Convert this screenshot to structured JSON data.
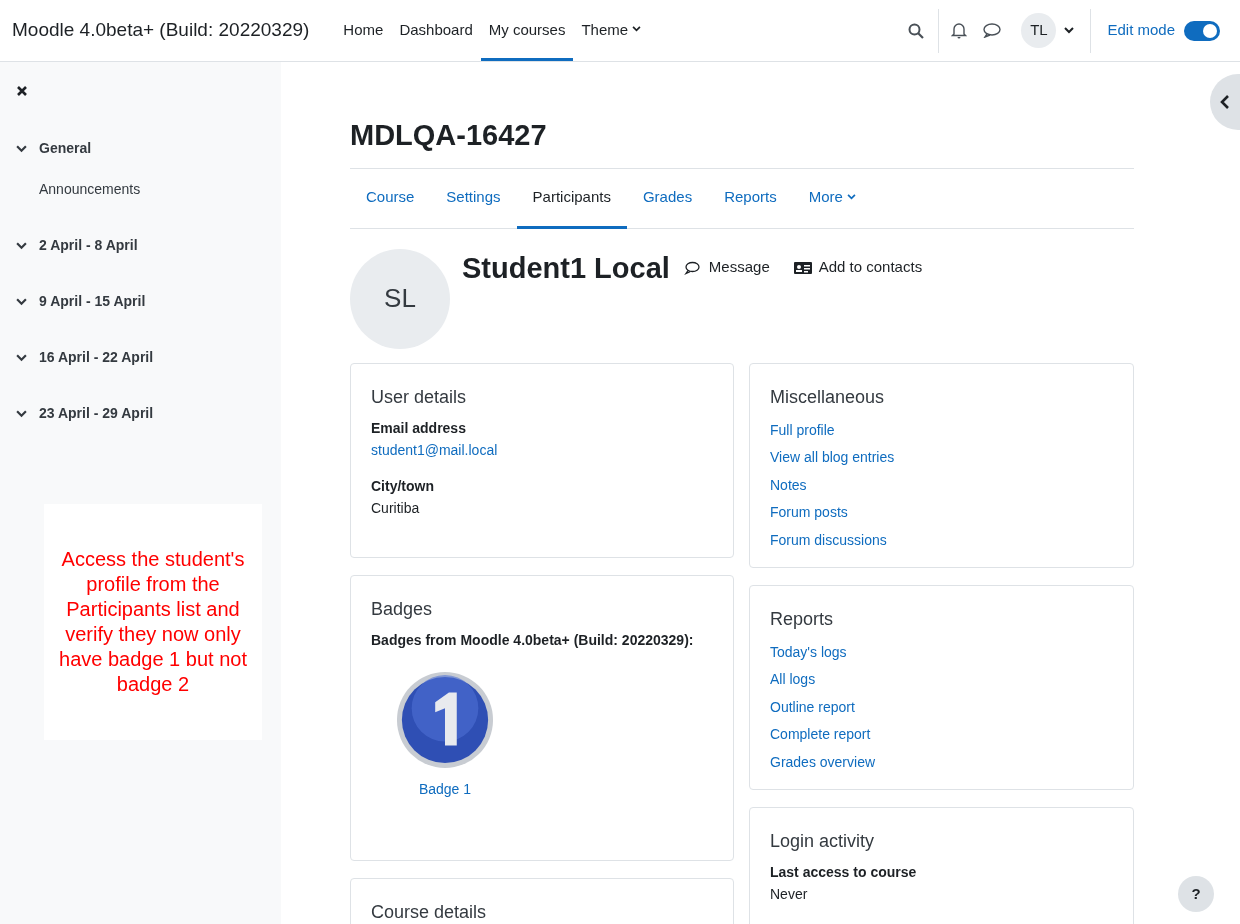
{
  "navbar": {
    "site_name": "Moodle 4.0beta+ (Build: 20220329)",
    "links": [
      {
        "label": "Home",
        "selected": false,
        "dropdown": false
      },
      {
        "label": "Dashboard",
        "selected": false,
        "dropdown": false
      },
      {
        "label": "My courses",
        "selected": true,
        "dropdown": false
      },
      {
        "label": "Theme",
        "selected": false,
        "dropdown": true
      }
    ],
    "user_initials": "TL",
    "edit_mode": {
      "label": "Edit mode",
      "on": true
    }
  },
  "course_index": {
    "sections": [
      {
        "title": "General",
        "expanded": true,
        "children": [
          {
            "title": "Announcements"
          }
        ]
      },
      {
        "title": "2 April - 8 April",
        "expanded": true
      },
      {
        "title": "9 April - 15 April",
        "expanded": true
      },
      {
        "title": "16 April - 22 April",
        "expanded": true
      },
      {
        "title": "23 April - 29 April",
        "expanded": true
      }
    ]
  },
  "annotation": "Access the student's profile from the Participants list and verify they now only have badge 1 but not badge 2",
  "course": {
    "title": "MDLQA-16427",
    "tabs": [
      {
        "label": "Course",
        "selected": false,
        "dropdown": false
      },
      {
        "label": "Settings",
        "selected": false,
        "dropdown": false
      },
      {
        "label": "Participants",
        "selected": true,
        "dropdown": false
      },
      {
        "label": "Grades",
        "selected": false,
        "dropdown": false
      },
      {
        "label": "Reports",
        "selected": false,
        "dropdown": false
      },
      {
        "label": "More",
        "selected": false,
        "dropdown": true
      }
    ]
  },
  "profile": {
    "initials": "SL",
    "name": "Student1 Local",
    "actions": [
      {
        "kind": "message",
        "label": "Message"
      },
      {
        "kind": "contact",
        "label": "Add to contacts"
      }
    ]
  },
  "left_cards": [
    {
      "title": "User details",
      "items": [
        {
          "kind": "field",
          "label": "Email address",
          "value": "student1@mail.local",
          "link": true
        },
        {
          "kind": "field",
          "label": "City/town",
          "value": "Curitiba",
          "link": false
        }
      ]
    },
    {
      "title": "Badges",
      "items": [
        {
          "kind": "badges",
          "label": "Badges from Moodle 4.0beta+ (Build: 20220329):",
          "badges": [
            {
              "name": "Badge 1"
            }
          ]
        }
      ]
    },
    {
      "title": "Course details"
    }
  ],
  "right_cards": [
    {
      "title": "Miscellaneous",
      "items": [
        {
          "kind": "link",
          "label": "Full profile"
        },
        {
          "kind": "link",
          "label": "View all blog entries"
        },
        {
          "kind": "link",
          "label": "Notes"
        },
        {
          "kind": "link",
          "label": "Forum posts"
        },
        {
          "kind": "link",
          "label": "Forum discussions"
        }
      ]
    },
    {
      "title": "Reports",
      "items": [
        {
          "kind": "link",
          "label": "Today's logs"
        },
        {
          "kind": "link",
          "label": "All logs"
        },
        {
          "kind": "link",
          "label": "Outline report"
        },
        {
          "kind": "link",
          "label": "Complete report"
        },
        {
          "kind": "link",
          "label": "Grades overview"
        }
      ]
    },
    {
      "title": "Login activity",
      "items": [
        {
          "kind": "field",
          "label": "Last access to course",
          "value": "Never",
          "link": false
        }
      ]
    }
  ],
  "help_button": "?"
}
